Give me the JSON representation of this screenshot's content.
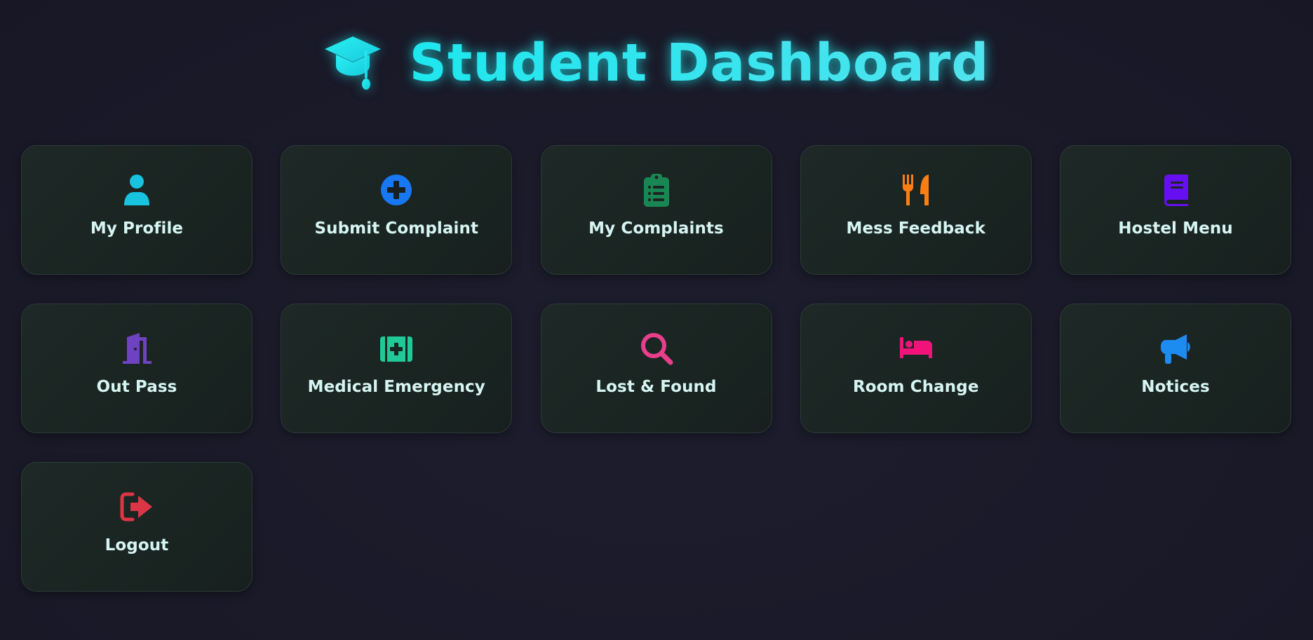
{
  "header": {
    "title": "Student Dashboard",
    "icon": "graduation-cap-icon",
    "title_color": "#22e6ec"
  },
  "cards": [
    {
      "label": "My Profile",
      "icon": "user-icon",
      "color": "#17c3df"
    },
    {
      "label": "Submit Complaint",
      "icon": "plus-circle-icon",
      "color": "#1877f2"
    },
    {
      "label": "My Complaints",
      "icon": "clipboard-list-icon",
      "color": "#198754"
    },
    {
      "label": "Mess Feedback",
      "icon": "utensils-icon",
      "color": "#fd7e14"
    },
    {
      "label": "Hostel Menu",
      "icon": "book-icon",
      "color": "#6610f2"
    },
    {
      "label": "Out Pass",
      "icon": "door-open-icon",
      "color": "#6f42c1"
    },
    {
      "label": "Medical Emergency",
      "icon": "medkit-icon",
      "color": "#20c997"
    },
    {
      "label": "Lost & Found",
      "icon": "search-icon",
      "color": "#e83e8c"
    },
    {
      "label": "Room Change",
      "icon": "bed-icon",
      "color": "#f0147a"
    },
    {
      "label": "Notices",
      "icon": "bullhorn-icon",
      "color": "#1d8cf0"
    },
    {
      "label": "Logout",
      "icon": "sign-out-icon",
      "color": "#dc3545"
    }
  ]
}
